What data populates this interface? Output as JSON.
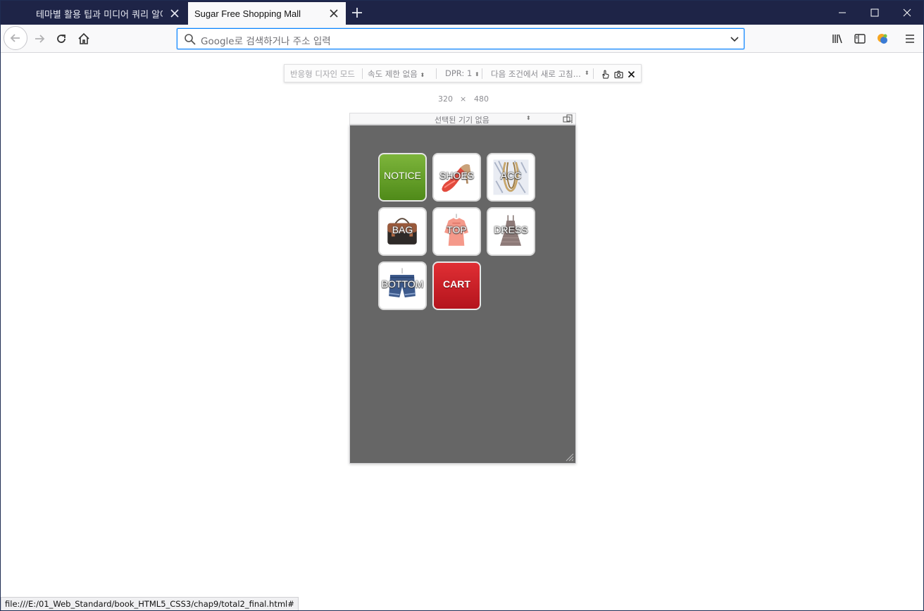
{
  "tabs": [
    {
      "title": "테마별 활용 팁과 미디어 쿼리 알아"
    },
    {
      "title": "Sugar Free Shopping Mall"
    }
  ],
  "urlbar": {
    "placeholder": "Google로 검색하거나 주소 입력"
  },
  "rdm": {
    "mode": "반응형 디자인 모드",
    "throttle": "속도 제한 없음",
    "dpr": "DPR: 1",
    "reload": "다음 조건에서 새로 고침...",
    "width": "320",
    "times": "×",
    "height": "480",
    "device": "선택된 기기 없음"
  },
  "menu": [
    {
      "label": "NOTICE",
      "kind": "notice"
    },
    {
      "label": "SHOES",
      "kind": "image"
    },
    {
      "label": "ACC",
      "kind": "image"
    },
    {
      "label": "BAG",
      "kind": "image"
    },
    {
      "label": "TOP",
      "kind": "image"
    },
    {
      "label": "DRESS",
      "kind": "image"
    },
    {
      "label": "BOTTOM",
      "kind": "image"
    },
    {
      "label": "CART",
      "kind": "cart"
    }
  ],
  "status": {
    "url": "file:///E:/01_Web_Standard/book_HTML5_CSS3/chap9/total2_final.html#"
  },
  "colors": {
    "titlebar": "#1e2447",
    "notice": "#6ca52d",
    "cart": "#cc1f27",
    "viewport_bg": "#666666",
    "focus": "#0a84ff"
  }
}
